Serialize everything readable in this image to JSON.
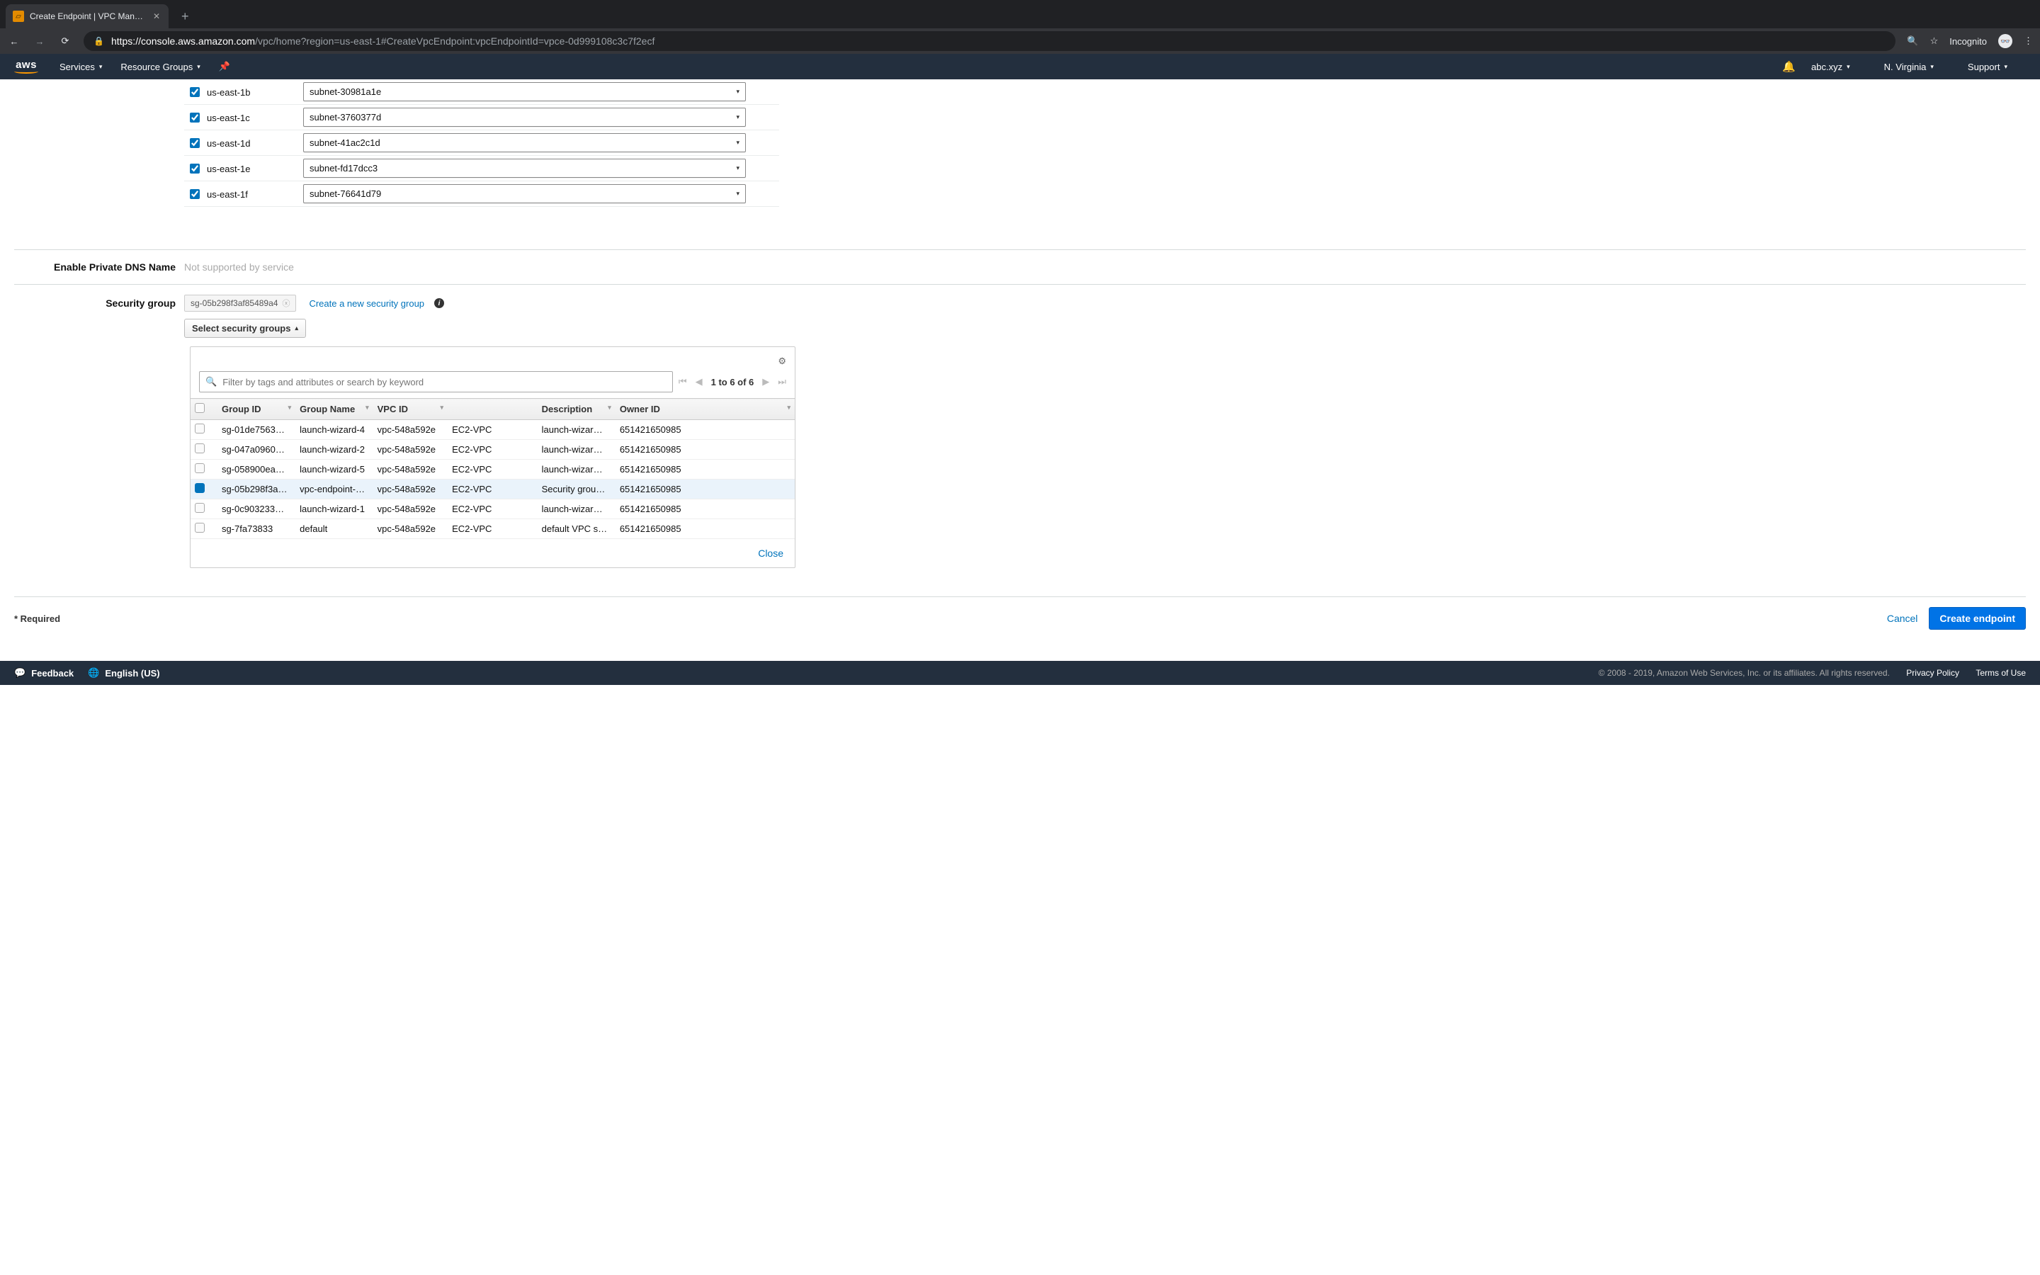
{
  "browser": {
    "tab_title": "Create Endpoint | VPC Manage",
    "url_host": "https://console.aws.amazon.com",
    "url_path": "/vpc/home?region=us-east-1#CreateVpcEndpoint:vpcEndpointId=vpce-0d999108c3c7f2ecf",
    "incognito_label": "Incognito"
  },
  "nav": {
    "services": "Services",
    "resource_groups": "Resource Groups",
    "account": "abc.xyz",
    "region": "N. Virginia",
    "support": "Support"
  },
  "subnets": [
    {
      "az": "us-east-1b",
      "subnet": "subnet-30981a1e"
    },
    {
      "az": "us-east-1c",
      "subnet": "subnet-3760377d"
    },
    {
      "az": "us-east-1d",
      "subnet": "subnet-41ac2c1d"
    },
    {
      "az": "us-east-1e",
      "subnet": "subnet-fd17dcc3"
    },
    {
      "az": "us-east-1f",
      "subnet": "subnet-76641d79"
    }
  ],
  "dns": {
    "label": "Enable Private DNS Name",
    "hint": "Not supported by service"
  },
  "sg": {
    "label": "Security group",
    "selected_tag": "sg-05b298f3af85489a4",
    "create_link": "Create a new security group",
    "toggle": "Select security groups",
    "search_placeholder": "Filter by tags and attributes or search by keyword",
    "pager": "1 to 6 of 6",
    "headers": {
      "group_id": "Group ID",
      "group_name": "Group Name",
      "vpc_id": "VPC ID",
      "type_col": "",
      "description": "Description",
      "owner_id": "Owner ID"
    },
    "rows": [
      {
        "checked": false,
        "group_id": "sg-01de7563…",
        "group_name": "launch-wizard-4",
        "vpc_id": "vpc-548a592e",
        "type": "EC2-VPC",
        "description": "launch-wizar…",
        "owner_id": "651421650985"
      },
      {
        "checked": false,
        "group_id": "sg-047a0960…",
        "group_name": "launch-wizard-2",
        "vpc_id": "vpc-548a592e",
        "type": "EC2-VPC",
        "description": "launch-wizar…",
        "owner_id": "651421650985"
      },
      {
        "checked": false,
        "group_id": "sg-058900ea…",
        "group_name": "launch-wizard-5",
        "vpc_id": "vpc-548a592e",
        "type": "EC2-VPC",
        "description": "launch-wizar…",
        "owner_id": "651421650985"
      },
      {
        "checked": true,
        "group_id": "sg-05b298f3a…",
        "group_name": "vpc-endpoint-…",
        "vpc_id": "vpc-548a592e",
        "type": "EC2-VPC",
        "description": "Security grou…",
        "owner_id": "651421650985"
      },
      {
        "checked": false,
        "group_id": "sg-0c903233…",
        "group_name": "launch-wizard-1",
        "vpc_id": "vpc-548a592e",
        "type": "EC2-VPC",
        "description": "launch-wizar…",
        "owner_id": "651421650985"
      },
      {
        "checked": false,
        "group_id": "sg-7fa73833",
        "group_name": "default",
        "vpc_id": "vpc-548a592e",
        "type": "EC2-VPC",
        "description": "default VPC s…",
        "owner_id": "651421650985"
      }
    ],
    "close": "Close"
  },
  "actions": {
    "required": "* Required",
    "cancel": "Cancel",
    "create": "Create endpoint"
  },
  "footer": {
    "feedback": "Feedback",
    "language": "English (US)",
    "copyright": "© 2008 - 2019, Amazon Web Services, Inc. or its affiliates. All rights reserved.",
    "privacy": "Privacy Policy",
    "terms": "Terms of Use"
  }
}
